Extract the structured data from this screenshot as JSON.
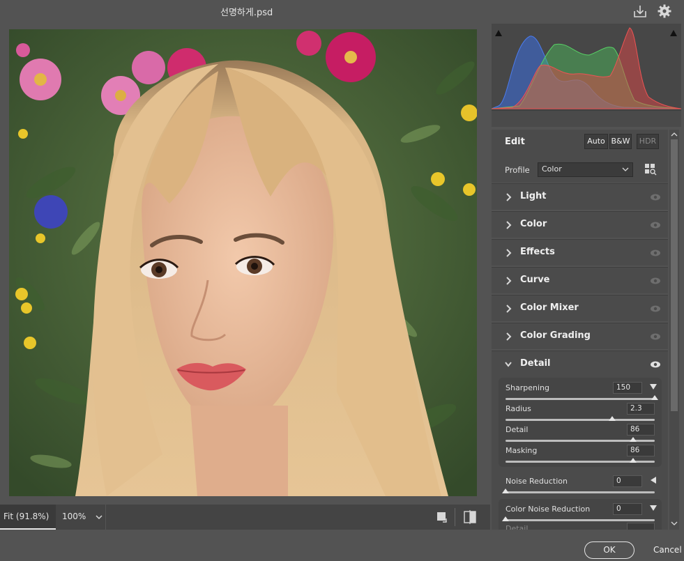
{
  "window": {
    "title": "선명하게.psd"
  },
  "view": {
    "fit_label": "Fit (91.8%)",
    "zoom_label": "100%"
  },
  "edit": {
    "title": "Edit",
    "modes": [
      "Auto",
      "B&W",
      "HDR"
    ],
    "profile_label": "Profile",
    "profile_value": "Color"
  },
  "sections": [
    {
      "label": "Light"
    },
    {
      "label": "Color"
    },
    {
      "label": "Effects"
    },
    {
      "label": "Curve"
    },
    {
      "label": "Color Mixer"
    },
    {
      "label": "Color Grading"
    },
    {
      "label": "Detail"
    }
  ],
  "detail": {
    "sharpening": {
      "label": "Sharpening",
      "value": "150"
    },
    "radius": {
      "label": "Radius",
      "value": "2.3"
    },
    "detail": {
      "label": "Detail",
      "value": "86"
    },
    "masking": {
      "label": "Masking",
      "value": "86"
    },
    "noise_reduction": {
      "label": "Noise Reduction",
      "value": "0"
    },
    "color_noise_reduction": {
      "label": "Color Noise Reduction",
      "value": "0"
    },
    "cn_detail_label": "Detail"
  },
  "dialog": {
    "ok_label": "OK",
    "cancel_label": "Cancel"
  },
  "colors": {
    "panel_bg": "#535353",
    "section_bg": "#4b4b4b",
    "hist_red": "#e04848",
    "hist_green": "#4cc05a",
    "hist_blue": "#3a6ee0"
  }
}
